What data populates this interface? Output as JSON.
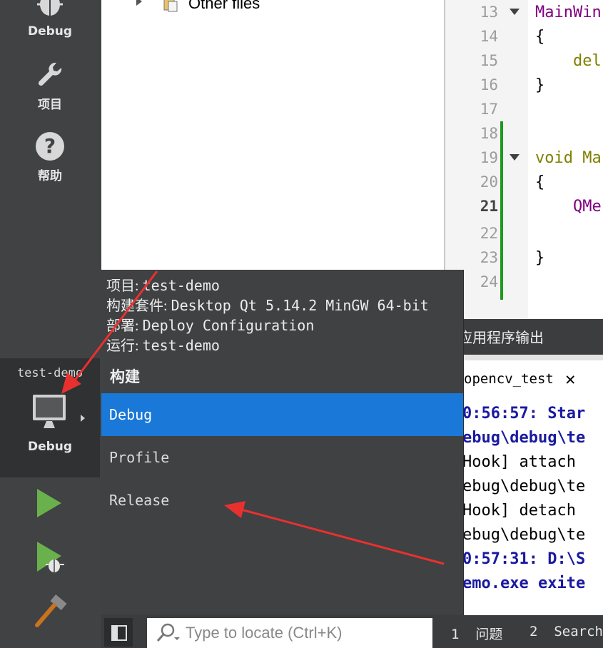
{
  "modes": [
    {
      "label": "Debug",
      "icon": "bug-icon"
    },
    {
      "label": "项目",
      "icon": "wrench-icon"
    },
    {
      "label": "帮助",
      "icon": "help-icon"
    }
  ],
  "kit_selector": {
    "project": "test-demo",
    "build": "Debug",
    "icon": "monitor-icon"
  },
  "actions": [
    {
      "name": "run",
      "icon": "run-icon"
    },
    {
      "name": "debug-run",
      "icon": "run-debug-icon"
    },
    {
      "name": "build",
      "icon": "hammer-icon"
    }
  ],
  "tree": {
    "item_label": "Other files"
  },
  "editor": {
    "lines": [
      {
        "num": "13",
        "code": "MainWin"
      },
      {
        "num": "14",
        "code": "{"
      },
      {
        "num": "15",
        "code": "    del"
      },
      {
        "num": "16",
        "code": "}"
      },
      {
        "num": "17",
        "code": ""
      },
      {
        "num": "18",
        "code": ""
      },
      {
        "num": "19",
        "code": "void Ma"
      },
      {
        "num": "20",
        "code": "{"
      },
      {
        "num": "21",
        "code": "    QMe"
      },
      {
        "num": "22",
        "code": ""
      },
      {
        "num": "23",
        "code": "}"
      },
      {
        "num": "24",
        "code": ""
      }
    ]
  },
  "output": {
    "title": "应用程序输出",
    "tab_label": "opencv_test",
    "lines": [
      "0:56:57: Star",
      "ebug\\debug\\te",
      "Hook] attach",
      "ebug\\debug\\te",
      "Hook] detach",
      "ebug\\debug\\te",
      "0:57:31: D:\\S",
      "emo.exe exite"
    ]
  },
  "popup": {
    "info": [
      {
        "key": "项目: ",
        "val": "test-demo"
      },
      {
        "key": "构建套件: ",
        "val": "Desktop Qt 5.14.2 MinGW 64-bit"
      },
      {
        "key": "部署: ",
        "val": "Deploy Configuration"
      },
      {
        "key": "运行: ",
        "val": "test-demo"
      }
    ],
    "section_title": "构建",
    "options": [
      "Debug",
      "Profile",
      "Release"
    ],
    "selected": "Debug"
  },
  "bottombar": {
    "locator_placeholder": "Type to locate (Ctrl+K)",
    "tabs": [
      {
        "num": "1",
        "label": "问题"
      },
      {
        "num": "2",
        "label": "Search"
      }
    ]
  },
  "colors": {
    "selection": "#1a78d8",
    "annotation_arrow": "#e8312f",
    "run_green": "#6ab04c"
  }
}
